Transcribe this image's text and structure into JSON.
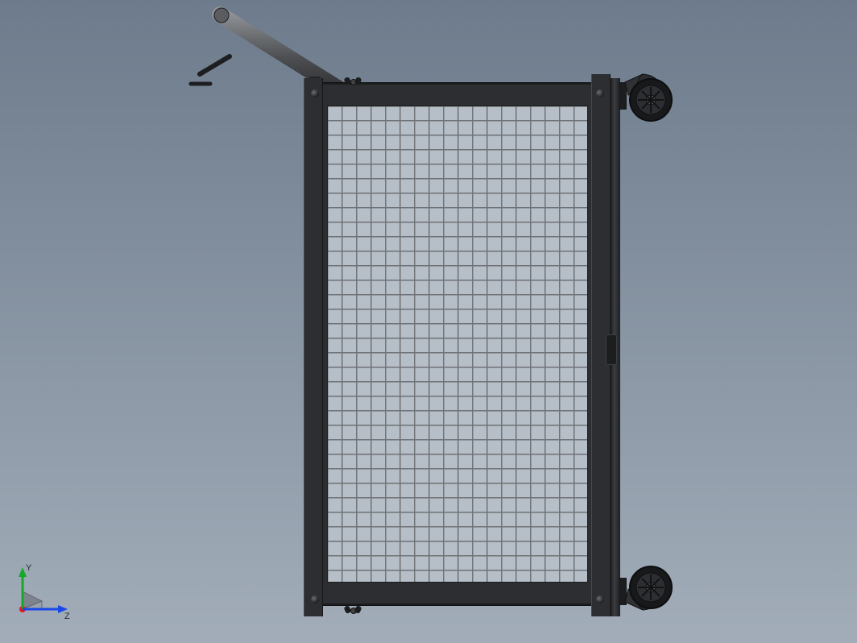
{
  "viewport": {
    "model": "cart-cage-assembly"
  },
  "triad": {
    "y_label": "Y",
    "z_label": "Z",
    "y_color": "#14a928",
    "z_color": "#1848e8",
    "x_color": "#e81818"
  }
}
